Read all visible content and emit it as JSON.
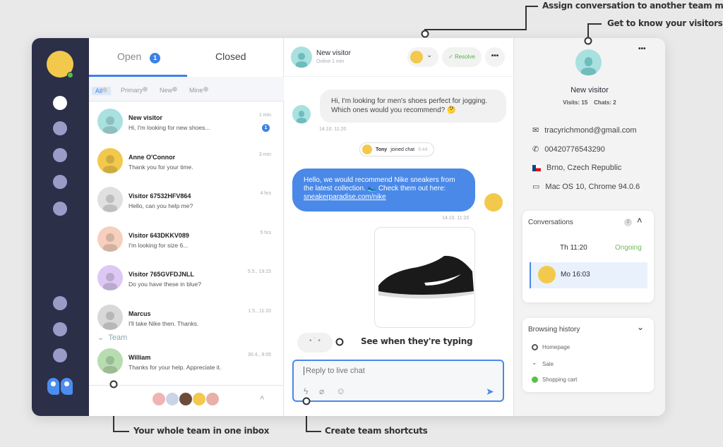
{
  "annotations": {
    "assign": "Assign conversation to another team member",
    "know_visitors": "Get to know your visitors",
    "typing": "See when they're typing",
    "team_inbox": "Your whole team in one inbox",
    "shortcuts": "Create team shortcuts"
  },
  "sidebar": {
    "items": [
      "nav-1",
      "nav-2",
      "nav-3",
      "nav-4",
      "nav-5",
      "nav-6",
      "nav-7",
      "nav-8"
    ],
    "logo_icon": "pp-logo-icon"
  },
  "list": {
    "tabs": [
      {
        "label": "Open",
        "count": "1"
      },
      {
        "label": "Closed"
      }
    ],
    "filters": [
      "All",
      "Primary",
      "New",
      "Mine"
    ],
    "conversations": [
      {
        "name": "New visitor",
        "message": "Hi, I'm looking for new shoes...",
        "time": "1 min",
        "unread": "1",
        "color": "#a9e0e0"
      },
      {
        "name": "Anne O'Connor",
        "message": "Thank you for your time.",
        "time": "3 min",
        "color": "#f2c94c"
      },
      {
        "name": "Visitor 67532HFV864",
        "message": "Hello, can you help me?",
        "time": "4 hrs",
        "color": "#e0e0e0"
      },
      {
        "name": "Visitor 643DKKV089",
        "message": "I'm looking for size 6...",
        "time": "5 hrs",
        "color": "#f6d0bd"
      },
      {
        "name": "Visitor 765GVFDJNLL",
        "message": "Do you have these in blue?",
        "time": "5.5., 19:15",
        "color": "#dcc8f2"
      },
      {
        "name": "Marcus",
        "message": "I'll take Nike then. Thanks.",
        "time": "1.5., 11:20",
        "color": "#d8d8d8"
      }
    ],
    "team_label": "Team",
    "team_conversations": [
      {
        "name": "William",
        "message": "Thanks for your help. Appreciate it.",
        "time": "30.4., 9:05",
        "color": "#b7dcb0"
      }
    ]
  },
  "chat": {
    "visitor_name": "New visitor",
    "status": "Online 1 min",
    "resolve_label": "Resolve",
    "messages": {
      "visitor_text": "Hi, I'm looking for men's shoes perfect for jogging. Which ones would you recommend? 🤔",
      "visitor_time": "14.10. 11:20",
      "join_name": "Tony",
      "join_text": "joined chat",
      "join_time": "9:44",
      "agent_text": "Hello, we would recommend Nike sneakers from the latest collection. 👟 Check them out here: ",
      "agent_link": "sneakerparadise.com/nike",
      "agent_time": "14.10. 11:20"
    },
    "reply_placeholder": "Reply to live chat",
    "accent": "#3b82e6"
  },
  "visitor": {
    "name": "New visitor",
    "visits": "Visits: 15",
    "chats": "Chats: 2",
    "email": "tracyrichmond@gmail.com",
    "phone": "00420776543290",
    "location": "Brno, Czech Republic",
    "device": "Mac OS 10, Chrome 94.0.6",
    "conversations_title": "Conversations",
    "conversations_count": "2",
    "conversations": [
      {
        "time": "Th 11:20",
        "status": "Ongoing"
      },
      {
        "time": "Mo 16:03"
      }
    ],
    "browsing_title": "Browsing history",
    "browsing": [
      "Homepage",
      "Sale",
      "Shopping cart"
    ]
  }
}
